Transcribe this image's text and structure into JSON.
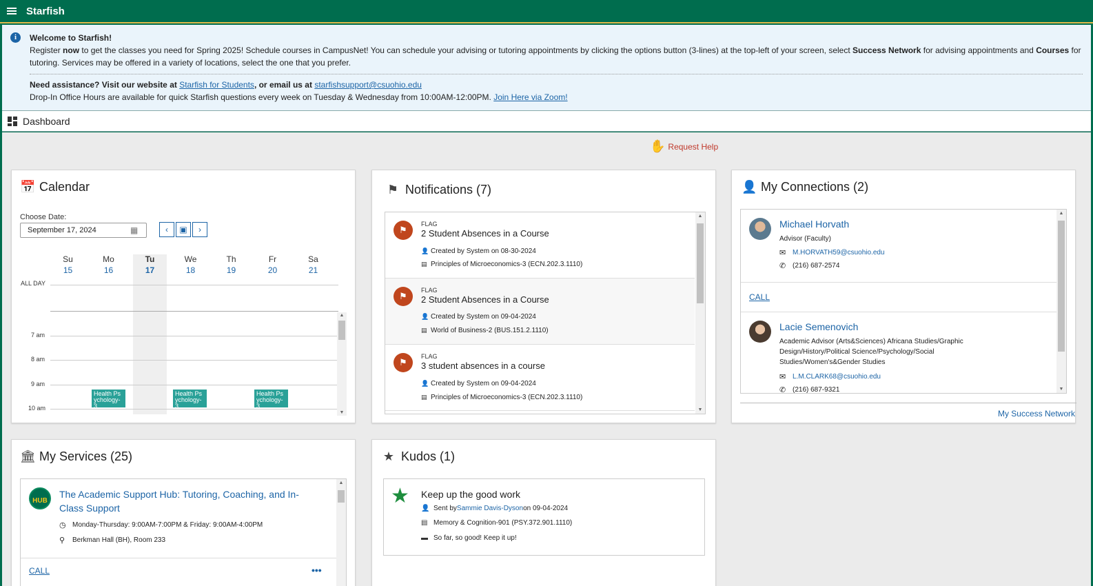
{
  "app": {
    "title": "Starfish"
  },
  "banner": {
    "heading": "Welcome to Starfish!",
    "line1_pre": "Register ",
    "line1_bold": "now",
    "line1_mid": " to get the classes you need for Spring 2025! Schedule courses in CampusNet! You can schedule your advising or tutoring appointments by clicking the options button (3-lines) at the top-left of your screen, select ",
    "line1_bold2": "Success Network",
    "line1_mid2": " for advising appointments and ",
    "line1_bold3": "Courses",
    "line1_end": " for",
    "line2": "tutoring. Services may be offered in a variety of locations, select the one that you prefer.",
    "help_pre": "Need assistance? Visit our website at ",
    "help_link1": "Starfish for Students",
    "help_mid": ", or email us at ",
    "help_link2": "starfishsupport@csuohio.edu",
    "dropin": "Drop-In Office Hours are available for quick Starfish questions every week on Tuesday & Wednesday from 10:00AM-12:00PM. ",
    "dropin_link": "Join Here via Zoom!"
  },
  "dashboard": {
    "label": "Dashboard"
  },
  "request_help": "Request Help",
  "calendar": {
    "title": "Calendar",
    "choose_date_label": "Choose Date:",
    "date_value": "September 17, 2024",
    "days": [
      {
        "name": "Su",
        "num": "15"
      },
      {
        "name": "Mo",
        "num": "16"
      },
      {
        "name": "Tu",
        "num": "17"
      },
      {
        "name": "We",
        "num": "18"
      },
      {
        "name": "Th",
        "num": "19"
      },
      {
        "name": "Fr",
        "num": "20"
      },
      {
        "name": "Sa",
        "num": "21"
      }
    ],
    "all_day": "ALL DAY",
    "hours": [
      "7 am",
      "8 am",
      "9 am",
      "10 am"
    ],
    "event_label": "Health Ps ychology-3"
  },
  "notifications": {
    "title": "Notifications (7)",
    "items": [
      {
        "type": "FLAG",
        "title": "2 Student Absences in a Course",
        "created": "Created by System on 08-30-2024",
        "course": "Principles of Microeconomics-3 (ECN.202.3.1110)"
      },
      {
        "type": "FLAG",
        "title": "2 Student Absences in a Course",
        "created": "Created by System on 09-04-2024",
        "course": "World of Business-2 (BUS.151.2.1110)"
      },
      {
        "type": "FLAG",
        "title": "3 student absences in a course",
        "created": "Created by System on 09-04-2024",
        "course": "Principles of Microeconomics-3 (ECN.202.3.1110)"
      }
    ]
  },
  "connections": {
    "title": "My Connections (2)",
    "people": [
      {
        "name": "Michael Horvath",
        "role": "Advisor (Faculty)",
        "email": "M.HORVATH59@csuohio.edu",
        "phone": "(216) 687-2574",
        "call": "CALL"
      },
      {
        "name": "Lacie Semenovich",
        "role": "Academic Advisor (Arts&Sciences) Africana Studies/Graphic Design/History/Political Science/Psychology/Social Studies/Women's&Gender Studies",
        "email": "L.M.CLARK68@csuohio.edu",
        "phone": "(216) 687-9321"
      }
    ],
    "footer_link": "My Success Network"
  },
  "services": {
    "title": "My Services (25)",
    "items": [
      {
        "logo": "HUB",
        "name": "The Academic Support Hub: Tutoring, Coaching, and In-Class Support",
        "hours": "Monday-Thursday: 9:00AM-7:00PM & Friday: 9:00AM-4:00PM",
        "location": "Berkman Hall (BH), Room 233",
        "call": "CALL",
        "more": "•••"
      }
    ]
  },
  "kudos": {
    "title": "Kudos (1)",
    "item": {
      "title": "Keep up the good work",
      "sent_pre": "Sent by ",
      "sent_by": "Sammie Davis-Dyson",
      "sent_post": " on 09-04-2024",
      "course": "Memory & Cognition-901 (PSY.372.901.1110)",
      "message": "So far, so good! Keep it up!"
    }
  },
  "colors": {
    "brand": "#006d4e",
    "accent": "#e0b84a",
    "link": "#1c64a6",
    "flag": "#c0461d",
    "event": "#2aa198"
  }
}
